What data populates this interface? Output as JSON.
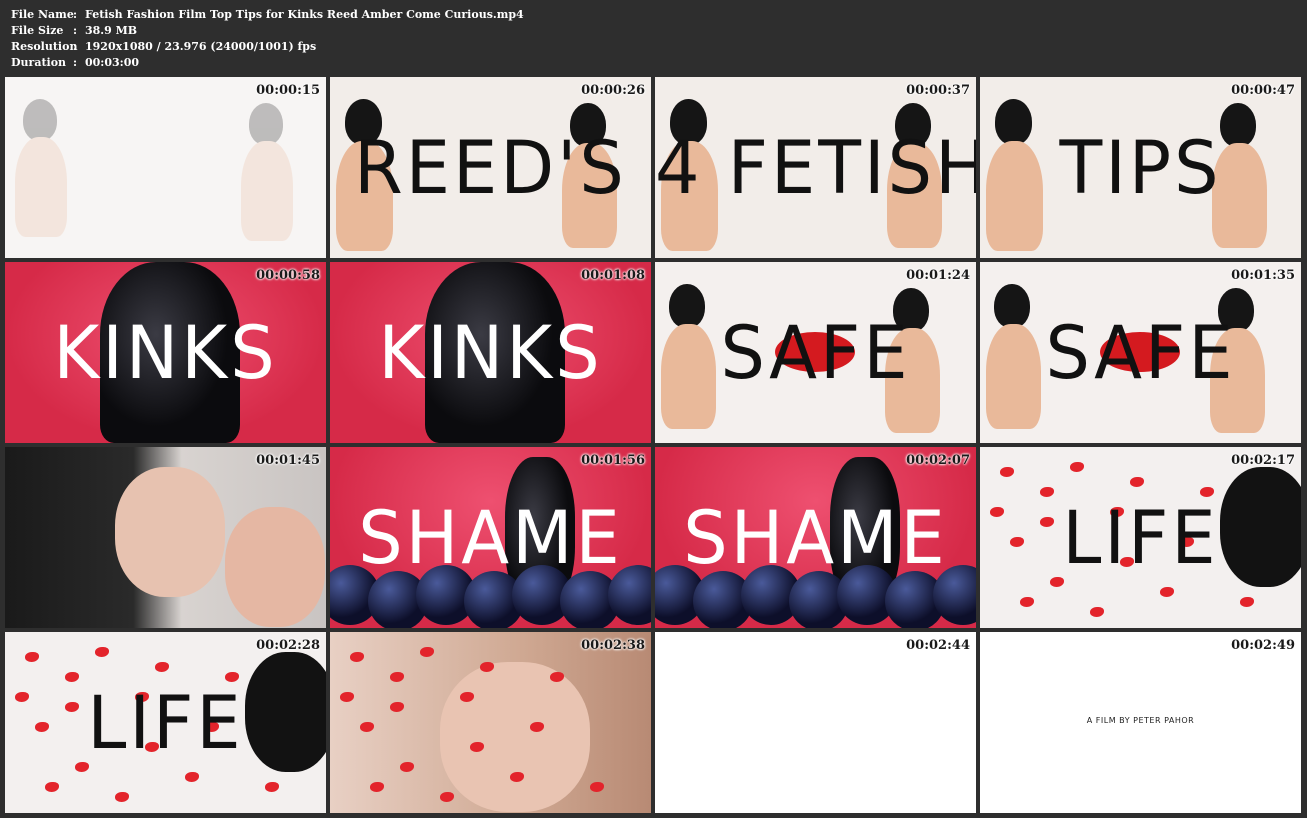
{
  "file_info": {
    "rows": [
      {
        "key": "File Name",
        "sep": ":",
        "value": "Fetish Fashion Film  Top Tips for Kinks  Reed Amber  Come Curious.mp4"
      },
      {
        "key": "File Size",
        "sep": ":",
        "value": "38.9 MB"
      },
      {
        "key": "Resolution",
        "sep": ":",
        "value": "1920x1080 / 23.976 (24000/1001) fps"
      },
      {
        "key": "Duration",
        "sep": ":",
        "value": "00:03:00"
      }
    ]
  },
  "thumbnails": [
    {
      "timestamp": "00:00:15",
      "overlay": "",
      "scene": "faded-mannequins"
    },
    {
      "timestamp": "00:00:26",
      "overlay": "REED'S",
      "scene": "mannequins"
    },
    {
      "timestamp": "00:00:37",
      "overlay": "4 FETISH",
      "scene": "mannequins"
    },
    {
      "timestamp": "00:00:47",
      "overlay": "TIPS",
      "scene": "mannequins"
    },
    {
      "timestamp": "00:00:58",
      "overlay": "KINKS",
      "scene": "latex-red"
    },
    {
      "timestamp": "00:01:08",
      "overlay": "KINKS",
      "scene": "latex-red"
    },
    {
      "timestamp": "00:01:24",
      "overlay": "SAFE",
      "scene": "mannequins-model"
    },
    {
      "timestamp": "00:01:35",
      "overlay": "SAFE",
      "scene": "mannequins-model"
    },
    {
      "timestamp": "00:01:45",
      "overlay": "",
      "scene": "closeup"
    },
    {
      "timestamp": "00:01:56",
      "overlay": "SHAME",
      "scene": "balloons"
    },
    {
      "timestamp": "00:02:07",
      "overlay": "SHAME",
      "scene": "balloons"
    },
    {
      "timestamp": "00:02:17",
      "overlay": "LIFE",
      "scene": "roses"
    },
    {
      "timestamp": "00:02:28",
      "overlay": "LIFE",
      "scene": "roses"
    },
    {
      "timestamp": "00:02:38",
      "overlay": "",
      "scene": "closeup-roses"
    },
    {
      "timestamp": "00:02:44",
      "overlay": "",
      "scene": "blank"
    },
    {
      "timestamp": "00:02:49",
      "overlay": "",
      "scene": "credit",
      "credit": "A FILM BY PETER PAHOR"
    }
  ],
  "colors": {
    "background": "#2e2e2e",
    "info_text": "#ffffff",
    "red_backdrop": "#e0334f",
    "overlay_dark": "#111111",
    "overlay_light": "#ffffff"
  }
}
